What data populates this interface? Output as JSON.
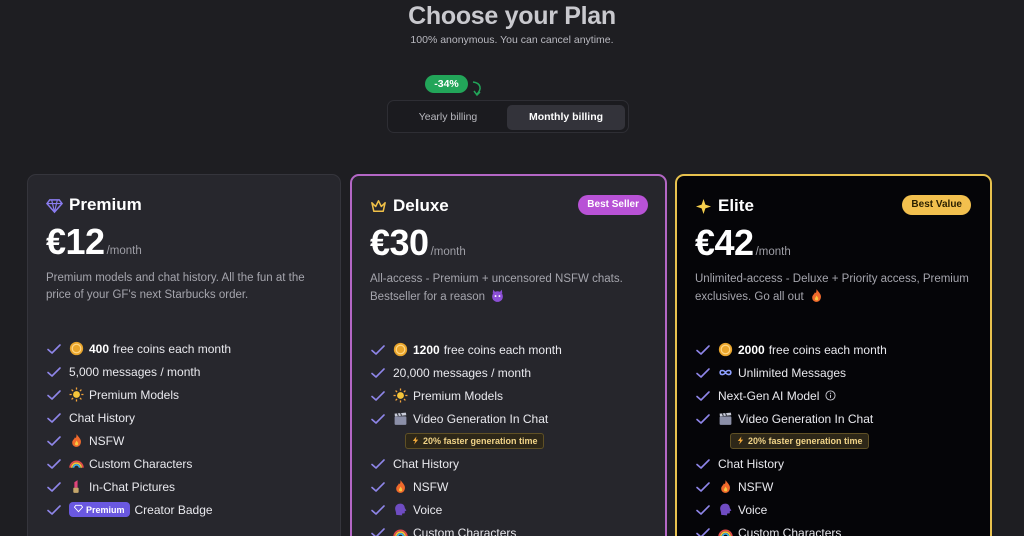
{
  "header": {
    "title": "Choose your Plan",
    "subtitle": "100% anonymous. You can cancel anytime."
  },
  "billing": {
    "discount": "-34%",
    "yearly_label": "Yearly billing",
    "monthly_label": "Monthly billing",
    "selected": "monthly"
  },
  "plans": [
    {
      "name": "Premium",
      "icon": "diamond-icon",
      "price": "€12",
      "period": "/month",
      "description": "Premium models and chat history. All the fun at the price of your GF's next Starbucks order.",
      "features": [
        {
          "bold": "400",
          "text": "free coins each month",
          "icon": "coin-icon"
        },
        {
          "text": "5,000 messages / month"
        },
        {
          "text": "Premium Models",
          "icon": "sun-icon"
        },
        {
          "text": "Chat History"
        },
        {
          "text": "NSFW",
          "icon": "fire-icon"
        },
        {
          "text": "Custom Characters",
          "icon": "rainbow-icon"
        },
        {
          "text": "In-Chat Pictures",
          "icon": "lipstick-icon"
        },
        {
          "badge": "Premium",
          "text": "Creator Badge"
        }
      ]
    },
    {
      "name": "Deluxe",
      "icon": "crown-icon",
      "badge": "Best Seller",
      "price": "€30",
      "period": "/month",
      "description": "All-access - Premium + uncensored NSFW chats. Bestseller for a reason",
      "description_icon": "devil-icon",
      "features": [
        {
          "bold": "1200",
          "text": "free coins each month",
          "icon": "coin-icon"
        },
        {
          "text": "20,000 messages / month"
        },
        {
          "text": "Premium Models",
          "icon": "sun-icon"
        },
        {
          "text": "Video Generation In Chat",
          "icon": "clapper-icon",
          "note": "20% faster generation time"
        },
        {
          "text": "Chat History"
        },
        {
          "text": "NSFW",
          "icon": "fire-icon"
        },
        {
          "text": "Voice",
          "icon": "speaking-head-icon"
        },
        {
          "text": "Custom Characters",
          "icon": "rainbow-icon"
        }
      ]
    },
    {
      "name": "Elite",
      "icon": "sparkle-icon",
      "badge": "Best Value",
      "price": "€42",
      "period": "/month",
      "description": "Unlimited-access - Deluxe + Priority access, Premium exclusives. Go all out",
      "description_icon": "fire-icon",
      "features": [
        {
          "bold": "2000",
          "text": "free coins each month",
          "icon": "coin-icon"
        },
        {
          "text": "Unlimited Messages",
          "icon": "infinity-icon"
        },
        {
          "text": "Next-Gen AI Model",
          "info": true
        },
        {
          "text": "Video Generation In Chat",
          "icon": "clapper-icon",
          "note": "20% faster generation time"
        },
        {
          "text": "Chat History"
        },
        {
          "text": "NSFW",
          "icon": "fire-icon"
        },
        {
          "text": "Voice",
          "icon": "speaking-head-icon"
        },
        {
          "text": "Custom Characters",
          "icon": "rainbow-icon"
        }
      ]
    }
  ],
  "colors": {
    "background": "#1e1e22",
    "discount_green": "#22a559",
    "deluxe_border": "#b467c6",
    "elite_border": "#e8c24e",
    "check": "#8f86ea"
  }
}
